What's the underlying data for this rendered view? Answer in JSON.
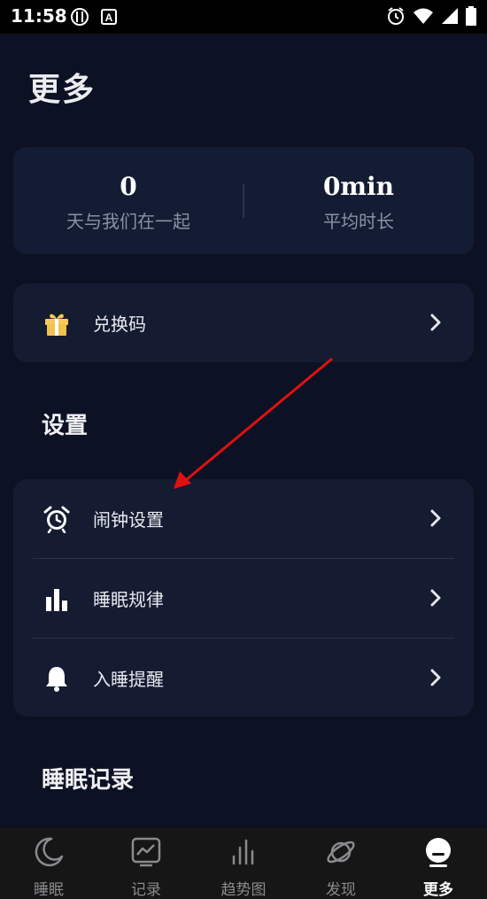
{
  "status_bar": {
    "time": "11:58",
    "colors": {
      "background": "#000000",
      "text": "#ffffff"
    }
  },
  "header": {
    "title": "更多"
  },
  "stats": {
    "days_value": "0",
    "days_label": "天与我们在一起",
    "avg_value": "0min",
    "avg_label": "平均时长"
  },
  "redeem": {
    "label": "兑换码",
    "icon": "gift-icon"
  },
  "settings": {
    "title": "设置",
    "items": [
      {
        "label": "闹钟设置",
        "icon": "alarm-clock-icon"
      },
      {
        "label": "睡眠规律",
        "icon": "bar-chart-icon"
      },
      {
        "label": "入睡提醒",
        "icon": "bell-icon"
      }
    ]
  },
  "sleep_records": {
    "title": "睡眠记录"
  },
  "tabs": [
    {
      "label": "睡眠",
      "icon": "moon-icon",
      "active": false
    },
    {
      "label": "记录",
      "icon": "chart-record-icon",
      "active": false
    },
    {
      "label": "趋势图",
      "icon": "trend-bars-icon",
      "active": false
    },
    {
      "label": "发现",
      "icon": "planet-icon",
      "active": false
    },
    {
      "label": "更多",
      "icon": "more-profile-icon",
      "active": true
    }
  ],
  "colors": {
    "background": "#0c1224",
    "card": "#151b31",
    "accent_gift": "#f2c14e",
    "annotation": "#e01010",
    "tab_bar": "#161616"
  }
}
